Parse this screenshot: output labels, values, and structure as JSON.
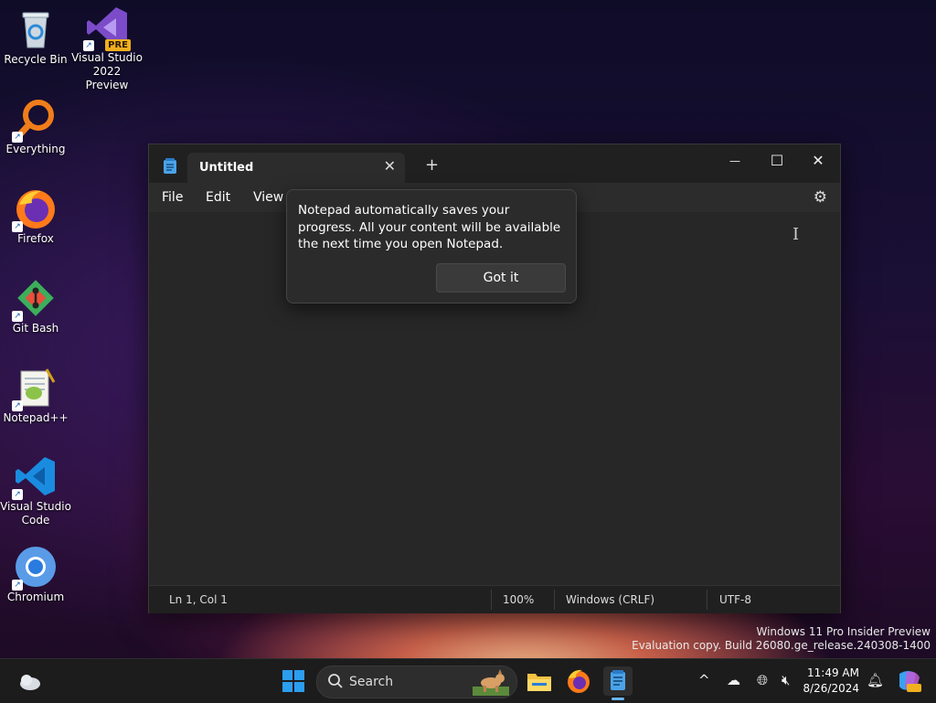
{
  "desktop": {
    "icons": [
      {
        "label": "Recycle Bin",
        "icon": "recycle-bin-icon"
      },
      {
        "label": "Visual Studio 2022 Preview",
        "icon": "visual-studio-icon",
        "badge": "PRE"
      },
      {
        "label": "Everything",
        "icon": "everything-icon"
      },
      {
        "label": "Firefox",
        "icon": "firefox-icon"
      },
      {
        "label": "Git Bash",
        "icon": "git-bash-icon"
      },
      {
        "label": "Notepad++",
        "icon": "notepadpp-icon"
      },
      {
        "label": "Visual Studio Code",
        "icon": "vscode-icon"
      },
      {
        "label": "Chromium",
        "icon": "chromium-icon"
      }
    ]
  },
  "notepad": {
    "tab_title": "Untitled",
    "tab_close": "✕",
    "new_tab": "+",
    "controls": {
      "minimize": "—",
      "maximize": "☐",
      "close": "✕"
    },
    "menu": {
      "file": "File",
      "edit": "Edit",
      "view": "View"
    },
    "popup": {
      "message": "Notepad automatically saves your progress. All your content will be available the next time you open Notepad.",
      "button": "Got it"
    },
    "status": {
      "position": "Ln 1, Col 1",
      "zoom": "100%",
      "line_ending": "Windows (CRLF)",
      "encoding": "UTF-8"
    }
  },
  "watermark": {
    "line1": "Windows 11 Pro Insider Preview",
    "line2": "Evaluation copy. Build 26080.ge_release.240308-1400"
  },
  "taskbar": {
    "search_label": "Search",
    "time": "11:49 AM",
    "date": "8/26/2024"
  },
  "colors": {
    "window_bg": "#272727",
    "titlebar_bg": "#202020",
    "accent": "#0078d4"
  }
}
